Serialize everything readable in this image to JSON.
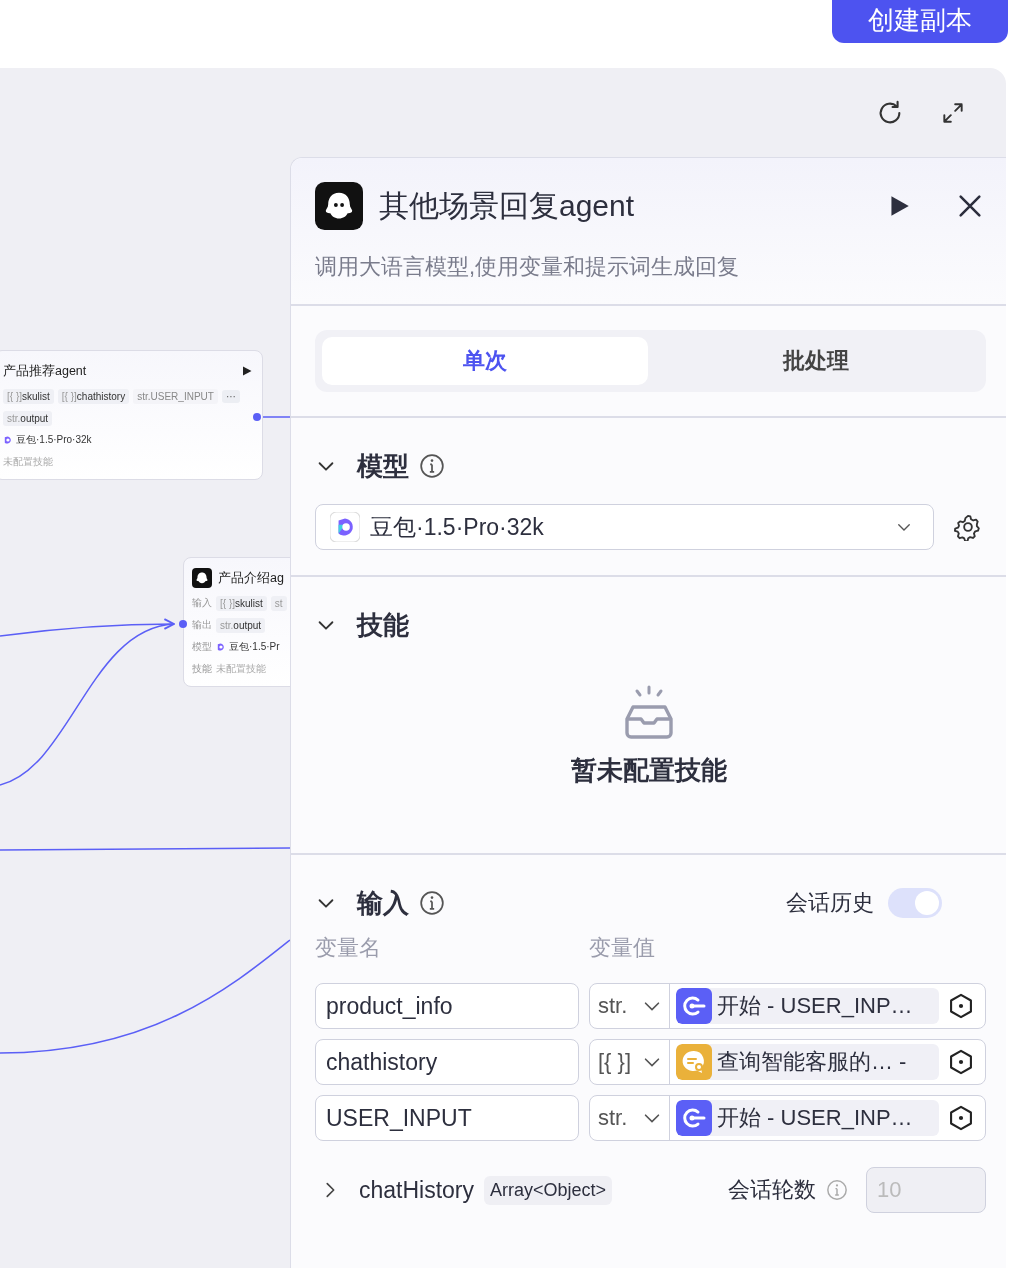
{
  "top_bar": {
    "button": "创建副本"
  },
  "canvas": {
    "nodes": [
      {
        "title": "产品推荐agent",
        "avatar": false,
        "run": true,
        "rows": [
          {
            "kind": "tags",
            "tags": [
              {
                "type": "[{ }]",
                "name": "skulist",
                "faded": false
              },
              {
                "type": "[{ }]",
                "name": "chathistory",
                "faded": false
              },
              {
                "type": "str.",
                "name": "USER_INPUT",
                "faded": true
              }
            ],
            "more": "···"
          },
          {
            "kind": "tags",
            "tags": [
              {
                "type": "str.",
                "name": "output",
                "faded": false
              }
            ]
          },
          {
            "kind": "model",
            "text": "豆包·1.5·Pro·32k"
          },
          {
            "kind": "muted",
            "text": "未配置技能"
          }
        ]
      },
      {
        "title": "产品介绍ag",
        "avatar": true,
        "run": false,
        "rows": [
          {
            "kind": "tags",
            "label": "输入",
            "tags": [
              {
                "type": "[{ }]",
                "name": "skulist",
                "faded": false
              },
              {
                "type": "st"
              }
            ]
          },
          {
            "kind": "tags",
            "label": "输出",
            "tags": [
              {
                "type": "str.",
                "name": "output",
                "faded": false
              }
            ]
          },
          {
            "kind": "model",
            "label": "模型",
            "text": "豆包·1.5·Pr"
          },
          {
            "kind": "muted",
            "label": "技能",
            "text": "未配置技能"
          }
        ]
      }
    ]
  },
  "panel": {
    "title": "其他场景回复agent",
    "description": "调用大语言模型,使用变量和提示词生成回复",
    "tabs": [
      {
        "label": "单次",
        "selected": true
      },
      {
        "label": "批处理",
        "selected": false
      }
    ],
    "model_section": {
      "title": "模型",
      "expanded": true,
      "model": "豆包·1.5·Pro·32k"
    },
    "skills_section": {
      "title": "技能",
      "expanded": true,
      "empty_text": "暂未配置技能"
    },
    "input_section": {
      "title": "输入",
      "expanded": true,
      "history_label": "会话历史",
      "history_on": true,
      "columns": [
        "变量名",
        "变量值"
      ],
      "rows": [
        {
          "name": "product_info",
          "type": "str.",
          "kind": "start",
          "color": "#5b5ff6",
          "value": "开始 - USER_INP…"
        },
        {
          "name": "chathistory",
          "type": "[{ }]",
          "kind": "query",
          "color": "#eab13a",
          "value": "查询智能客服的… -"
        },
        {
          "name": "USER_INPUT",
          "type": "str.",
          "kind": "start",
          "color": "#5b5ff6",
          "value": "开始 - USER_INP…"
        }
      ],
      "chat_history": {
        "expanded": false,
        "name": "chatHistory",
        "type": "Array<Object>"
      },
      "rounds_label": "会话轮数",
      "rounds_value": "10",
      "rounds_disabled": true
    }
  }
}
